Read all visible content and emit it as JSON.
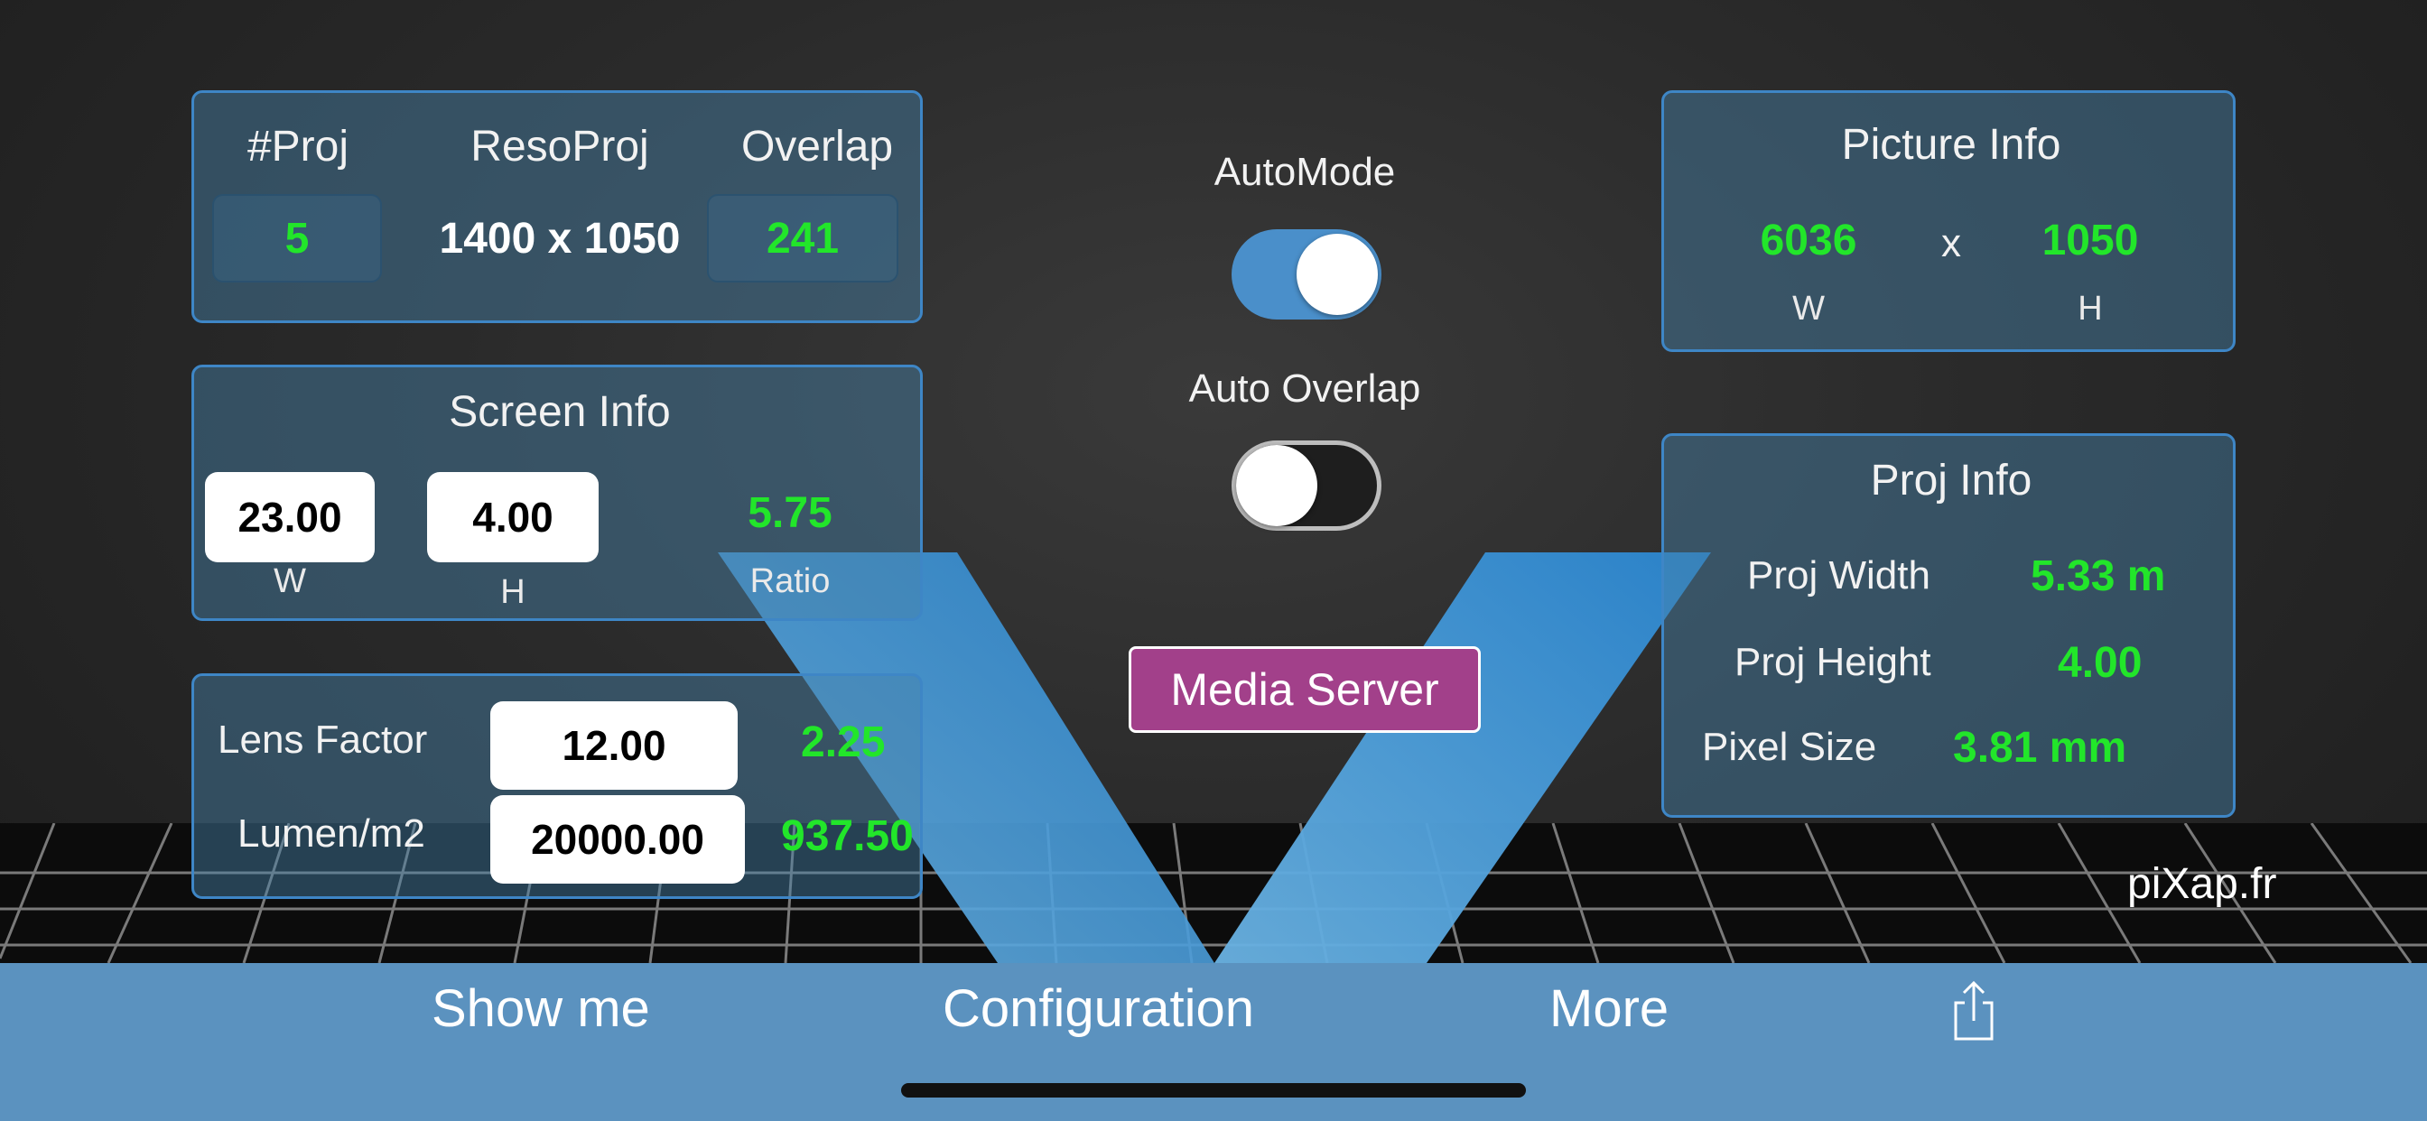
{
  "projectors": {
    "headers": {
      "count": "#Proj",
      "reso": "ResoProj",
      "overlap": "Overlap"
    },
    "count": "5",
    "reso": "1400 x 1050",
    "overlap": "241"
  },
  "screen_info": {
    "title": "Screen Info",
    "width": "23.00",
    "height": "4.00",
    "ratio": "5.75",
    "w_label": "W",
    "h_label": "H",
    "ratio_label": "Ratio"
  },
  "lens": {
    "lens_label": "Lens Factor",
    "lens_value": "12.00",
    "lens_result": "2.25",
    "lumen_label": "Lumen/m2",
    "lumen_value": "20000.00",
    "lumen_result": "937.50"
  },
  "controls": {
    "automode_label": "AutoMode",
    "automode_on": true,
    "auto_overlap_label": "Auto Overlap",
    "auto_overlap_on": false,
    "media_server_label": "Media Server"
  },
  "picture_info": {
    "title": "Picture Info",
    "width": "6036",
    "sep": "x",
    "height": "1050",
    "w_label": "W",
    "h_label": "H"
  },
  "proj_info": {
    "title": "Proj Info",
    "rows": [
      {
        "label": "Proj Width",
        "value": "5.33 m"
      },
      {
        "label": "Proj Height",
        "value": "4.00"
      },
      {
        "label": "Pixel Size",
        "value": "3.81 mm"
      }
    ]
  },
  "brand": "piXap.fr",
  "toolbar": {
    "tabs": [
      "Show me",
      "Configuration",
      "More"
    ],
    "share_icon": "share-icon"
  },
  "colors": {
    "accent_green": "#22e62a",
    "panel_border": "#3e86c6",
    "toolbar": "#5b92bf",
    "media_button": "#a2408a"
  }
}
